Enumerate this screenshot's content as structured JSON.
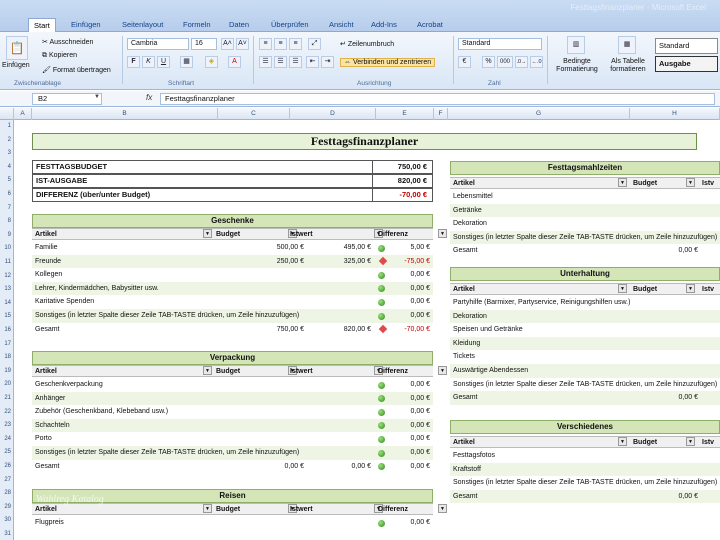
{
  "window_title": "Festtagsfinanzplaner - Microsoft Excel",
  "ribbon_tabs": [
    "Start",
    "Einfügen",
    "Seitenlayout",
    "Formeln",
    "Daten",
    "Überprüfen",
    "Ansicht",
    "Add-Ins",
    "Acrobat"
  ],
  "ribbon": {
    "clipboard": {
      "paste": "Einfügen",
      "cut": "Ausschneiden",
      "copy": "Kopieren",
      "format_painter": "Format übertragen",
      "group": "Zwischenablage"
    },
    "font": {
      "family": "Cambria",
      "size": "16",
      "group": "Schriftart"
    },
    "alignment": {
      "wrap": "Zeilenumbruch",
      "merge": "Verbinden und zentrieren",
      "group": "Ausrichtung"
    },
    "number": {
      "format": "Standard",
      "group": "Zahl"
    },
    "styles": {
      "conditional": "Bedingte Formatierung",
      "as_table": "Als Tabelle formatieren",
      "style_standard": "Standard",
      "style_output": "Ausgabe"
    }
  },
  "formula_bar": {
    "cell": "B2",
    "fx": "fx",
    "content": "Festtagsfinanzplaner"
  },
  "columns": [
    "A",
    "B",
    "C",
    "D",
    "E",
    "F",
    "G",
    "H"
  ],
  "row_numbers": [
    "1",
    "2",
    "3",
    "4",
    "5",
    "6",
    "7",
    "8",
    "9",
    "10",
    "11",
    "12",
    "13",
    "14",
    "15",
    "16",
    "17",
    "18",
    "19",
    "20",
    "21",
    "22",
    "23",
    "24",
    "25",
    "26",
    "27",
    "28",
    "29",
    "30",
    "31"
  ],
  "title": "Festtagsfinanzplaner",
  "budget": [
    {
      "label": "FESTTAGSBUDGET",
      "value": "750,00 €"
    },
    {
      "label": "IST-AUSGABE",
      "value": "820,00 €"
    },
    {
      "label": "DIFFERENZ (über/unter Budget)",
      "value": "-70,00 €"
    }
  ],
  "headers": {
    "artikel": "Artikel",
    "budget": "Budget",
    "istwert": "Istwert",
    "differenz": "Differenz",
    "ist_short": "Istv"
  },
  "sonstiges_row": "Sonstiges (in letzter Spalte dieser Zeile TAB-TASTE drücken, um Zeile hinzuzufügen)",
  "geschenke": {
    "title": "Geschenke",
    "rows": [
      {
        "item": "Familie",
        "budget": "500,00 €",
        "ist": "495,00 €",
        "diff": "5,00 €",
        "status": "green"
      },
      {
        "item": "Freunde",
        "budget": "250,00 €",
        "ist": "325,00 €",
        "diff": "-75,00 €",
        "status": "red"
      },
      {
        "item": "Kollegen",
        "budget": "",
        "ist": "",
        "diff": "0,00 €",
        "status": "green"
      },
      {
        "item": "Lehrer, Kindermädchen, Babysitter usw.",
        "budget": "",
        "ist": "",
        "diff": "0,00 €",
        "status": "green"
      },
      {
        "item": "Karitative Spenden",
        "budget": "",
        "ist": "",
        "diff": "0,00 €",
        "status": "green"
      },
      {
        "item": "Sonstiges",
        "budget": "",
        "ist": "",
        "diff": "0,00 €",
        "status": "green"
      },
      {
        "item": "Gesamt",
        "budget": "750,00 €",
        "ist": "820,00 €",
        "diff": "-70,00 €",
        "status": "red"
      }
    ]
  },
  "verpackung": {
    "title": "Verpackung",
    "rows": [
      {
        "item": "Geschenkverpackung",
        "budget": "",
        "ist": "",
        "diff": "0,00 €",
        "status": "green"
      },
      {
        "item": "Anhänger",
        "budget": "",
        "ist": "",
        "diff": "0,00 €",
        "status": "green"
      },
      {
        "item": "Zubehör (Geschenkband, Klebeband usw.)",
        "budget": "",
        "ist": "",
        "diff": "0,00 €",
        "status": "green"
      },
      {
        "item": "Schachteln",
        "budget": "",
        "ist": "",
        "diff": "0,00 €",
        "status": "green"
      },
      {
        "item": "Porto",
        "budget": "",
        "ist": "",
        "diff": "0,00 €",
        "status": "green"
      },
      {
        "item": "Sonstiges",
        "budget": "",
        "ist": "",
        "diff": "0,00 €",
        "status": "green"
      },
      {
        "item": "Gesamt",
        "budget": "0,00 €",
        "ist": "0,00 €",
        "diff": "0,00 €",
        "status": "green"
      }
    ]
  },
  "reisen": {
    "title": "Reisen",
    "rows": [
      {
        "item": "Flugpreis",
        "budget": "",
        "ist": "",
        "diff": "0,00 €",
        "status": "green"
      }
    ]
  },
  "festtagsmahlzeiten": {
    "title": "Festtagsmahlzeiten",
    "rows": [
      {
        "item": "Lebensmittel",
        "budget": ""
      },
      {
        "item": "Getränke",
        "budget": ""
      },
      {
        "item": "Dekoration",
        "budget": ""
      },
      {
        "item": "Sonstiges",
        "budget": ""
      },
      {
        "item": "Gesamt",
        "budget": "0,00 €"
      }
    ]
  },
  "unterhaltung": {
    "title": "Unterhaltung",
    "rows": [
      {
        "item": "Partyhilfe (Barmixer, Partyservice, Reinigungshilfen usw.)",
        "budget": ""
      },
      {
        "item": "Dekoration",
        "budget": ""
      },
      {
        "item": "Speisen und Getränke",
        "budget": ""
      },
      {
        "item": "Kleidung",
        "budget": ""
      },
      {
        "item": "Tickets",
        "budget": ""
      },
      {
        "item": "Auswärtige Abendessen",
        "budget": ""
      },
      {
        "item": "Sonstiges",
        "budget": ""
      },
      {
        "item": "Gesamt",
        "budget": "0,00 €"
      }
    ]
  },
  "verschiedenes": {
    "title": "Verschiedenes",
    "rows": [
      {
        "item": "Festtagsfotos",
        "budget": ""
      },
      {
        "item": "Kraftstoff",
        "budget": ""
      },
      {
        "item": "Sonstiges",
        "budget": ""
      },
      {
        "item": "Gesamt",
        "budget": "0,00 €"
      }
    ]
  },
  "watermark": "Wahlreg Katalog",
  "colors": {
    "section_green": "#d4e5b8",
    "status_green": "#3a9a24",
    "status_red": "#e04a4a",
    "negative": "#c00000"
  }
}
